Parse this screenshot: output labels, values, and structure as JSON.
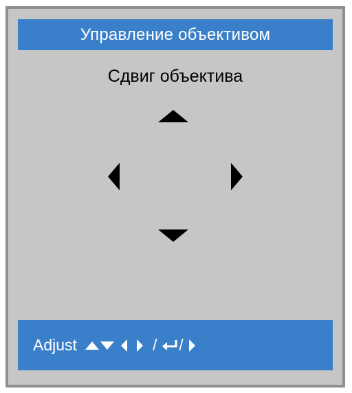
{
  "title": "Управление объективом",
  "subtitle": "Сдвиг объектива",
  "controls": {
    "up": "arrow-up",
    "down": "arrow-down",
    "left": "arrow-left",
    "right": "arrow-right"
  },
  "footer": {
    "label": "Adjust",
    "separator1": "/",
    "separator2": "/"
  },
  "colors": {
    "panel": "#c6c6c6",
    "border": "#8f8f8f",
    "accent": "#3a7fc9",
    "text": "#000000",
    "footer_text": "#ffffff"
  }
}
